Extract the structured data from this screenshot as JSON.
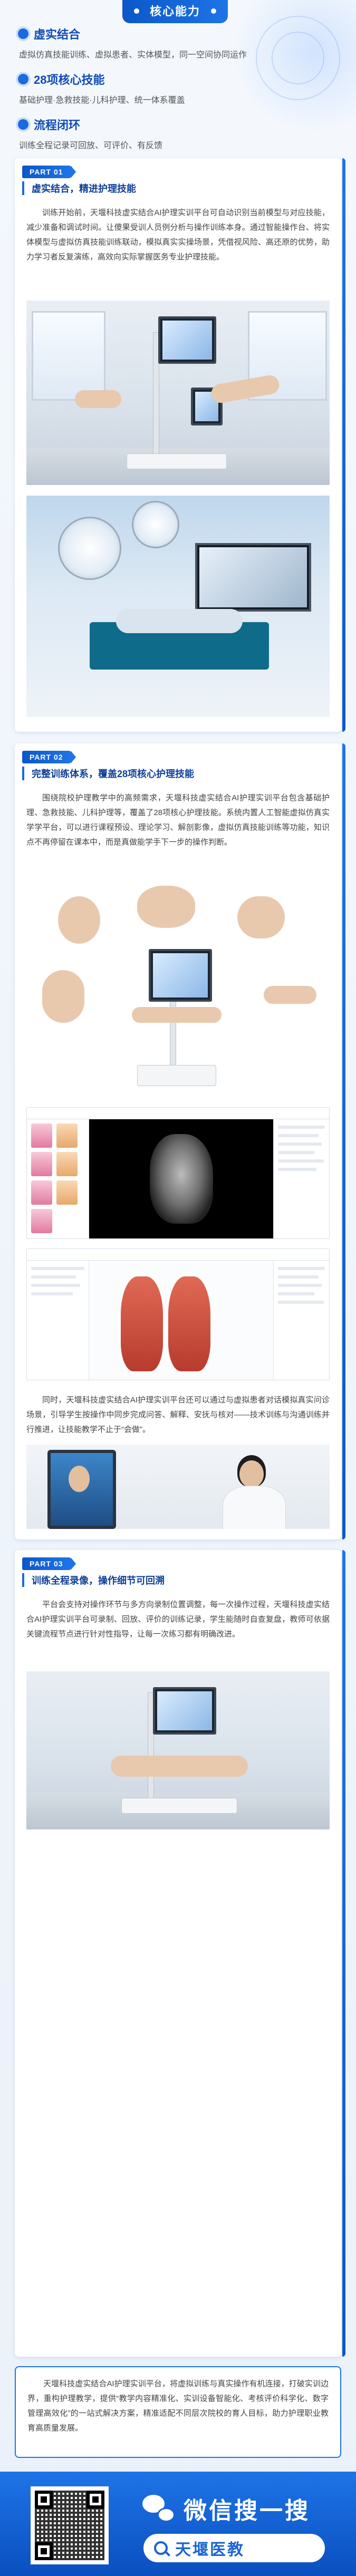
{
  "header": {
    "core_tag": "核心能力",
    "points": [
      {
        "title": "虚实结合",
        "desc": "虚拟仿真技能训练、虚拟患者、实体模型，同一空间协同运作"
      },
      {
        "title": "28项核心技能",
        "desc": "基础护理·急救技能·儿科护理、统一体系覆盖"
      },
      {
        "title": "流程闭环",
        "desc": "训练全程记录可回放、可评价、有反馈"
      }
    ]
  },
  "part1": {
    "tag": "PART 01",
    "title": "虚实结合，精进护理技能",
    "text": "训练开始前，天堰科技虚实结合AI护理实训平台可自动识别当前模型与对应技能，减少准备和调试时间。让傻果受训人员例分析与操作训练本身。通过智能操作台、将实体模型与虚拟仿真技能训练联动，模拟真实实操场景，凭借视风险、高还原的优势，助力学习者反复演练，高效向实际掌握医务专业护理技能。"
  },
  "part2": {
    "tag": "PART 02",
    "title": "完整训练体系，覆盖28项核心护理技能",
    "text1": "围绕院校护理教学中的高频需求，天堰科技虚实结合AI护理实训平台包含基础护理、急救技能、儿科护理等，覆盖了28项核心护理技能。系统内置人工智能虚拟仿真实学学平台，可以进行课程预设、理论学习、解剖影像，虚拟仿真技能训练等功能，知识点不再停留在课本中，而是真做能学手下一步的操作判断。",
    "text2": "同时，天堰科技虚实结合AI护理实训平台还可以通过与虚拟患者对话模拟真实问诊场景，引导学生按操作中同步完成问答、解释、安抚与核对——技术训练与沟通训练并行推进，让技能教学不止于“会做”。"
  },
  "part3": {
    "tag": "PART 03",
    "title": "训练全程录像，操作细节可回溯",
    "text": "平台会支持对操作环节与多方向录制位置调整，每一次操作过程，天堰科技虚实结合AI护理实训平台可录制、回放、评价的训练记录，学生能随时自查复盘，教师可依据关键流程节点进行针对性指导，让每一次练习都有明确改进。"
  },
  "summary": {
    "text": "天堰科技虚实结合AI护理实训平台，将虚拟训练与真实操作有机连接，打破实训边界，重构护理教学，提供“教学内容精准化、实训设备智能化、考核评价科学化、数字管理高效化”的一站式解决方案，精准适配不同层次院校的育人目标，助力护理职业教育高质量发展。"
  },
  "footer": {
    "wechat_label": "微信搜一搜",
    "search_keyword": "天堰医教"
  }
}
